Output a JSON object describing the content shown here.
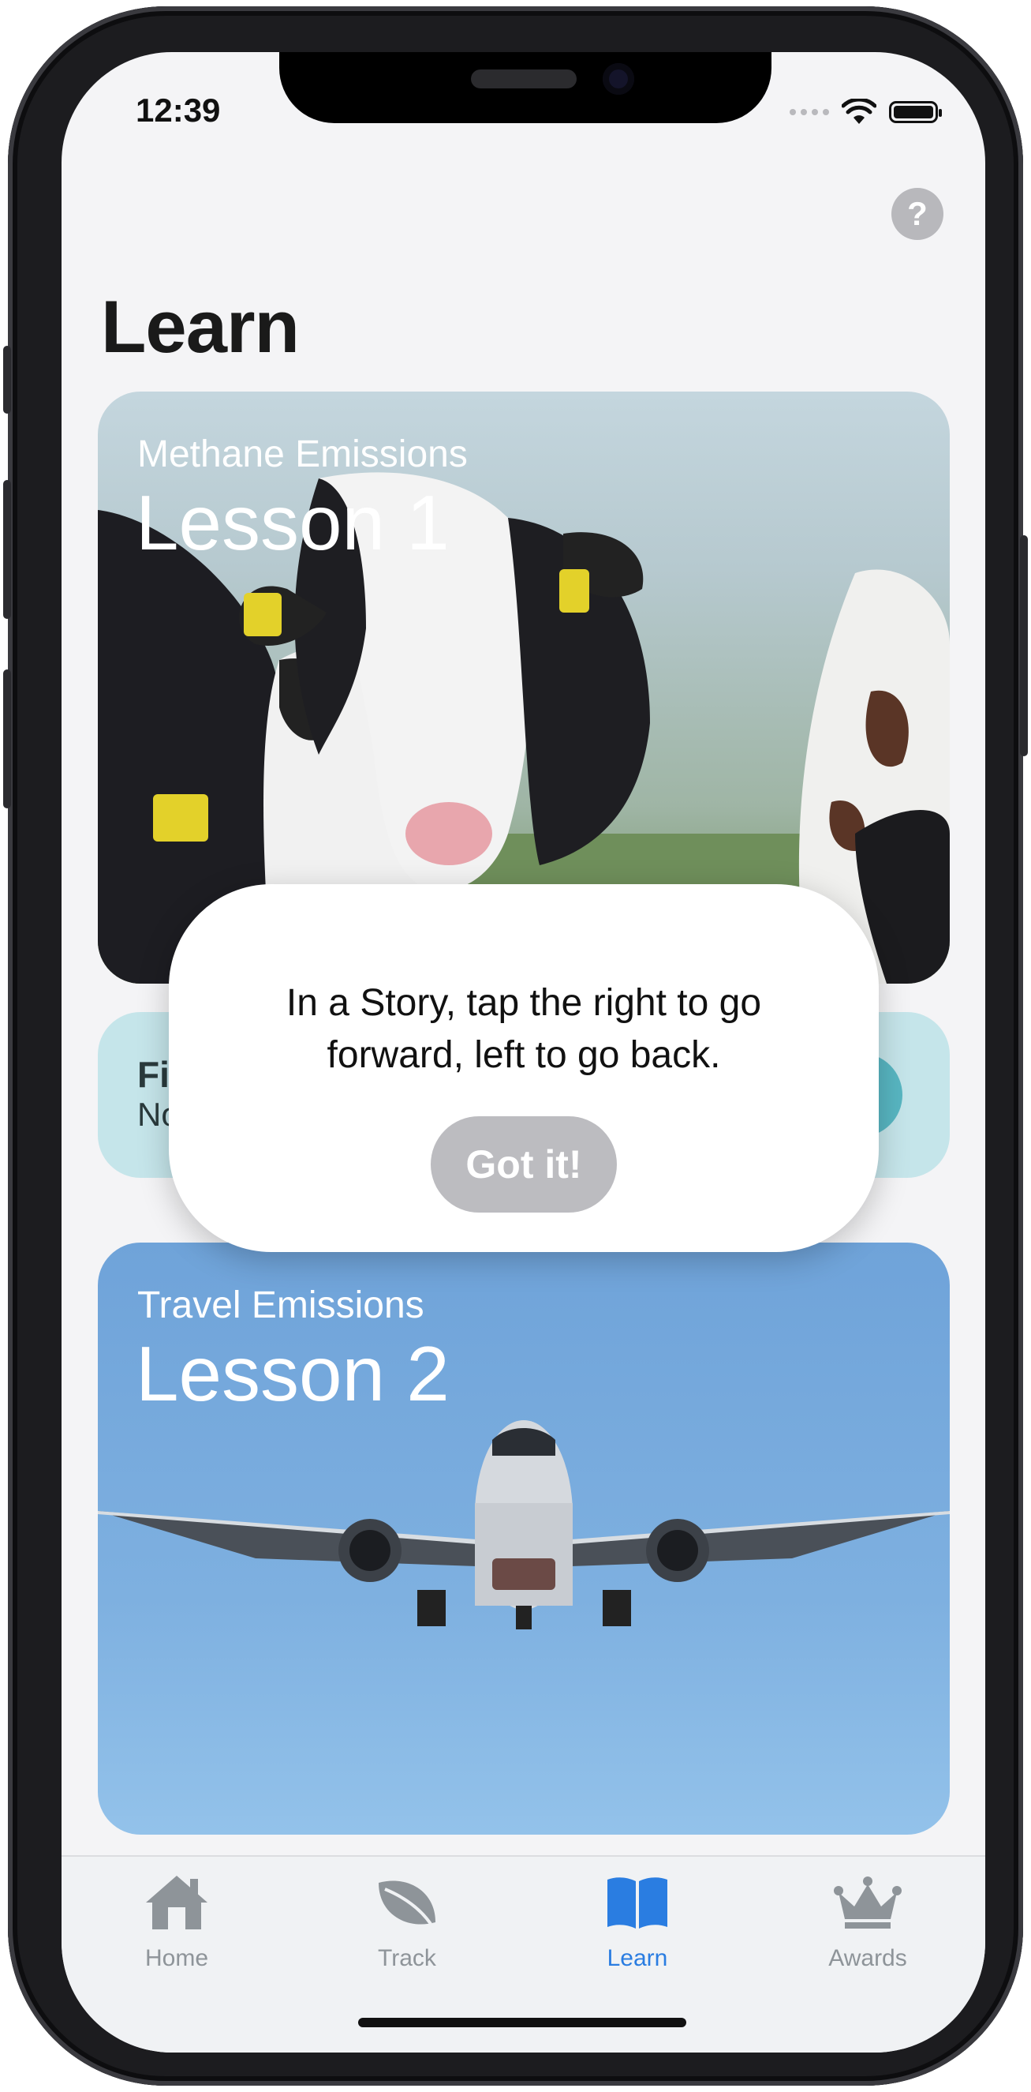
{
  "status_bar": {
    "time": "12:39"
  },
  "header": {
    "title": "Learn",
    "help_icon": "question-mark-icon",
    "help_symbol": "?"
  },
  "lessons": [
    {
      "subtitle": "Methane Emissions",
      "title": "Lesson 1",
      "image": "cows-photo"
    },
    {
      "subtitle": "Fi",
      "detail": "No",
      "image": "none"
    },
    {
      "subtitle": "Travel Emissions",
      "title": "Lesson 2",
      "image": "airplane-photo"
    }
  ],
  "popup": {
    "message": "In a Story, tap the right to go forward, left to go back.",
    "button_label": "Got it!"
  },
  "tabbar": {
    "items": [
      {
        "label": "Home",
        "icon": "house-icon",
        "active": false
      },
      {
        "label": "Track",
        "icon": "leaf-icon",
        "active": false
      },
      {
        "label": "Learn",
        "icon": "book-icon",
        "active": true
      },
      {
        "label": "Awards",
        "icon": "crown-icon",
        "active": false
      }
    ]
  },
  "colors": {
    "accent": "#2a7de1",
    "inactive_tab": "#8e9499",
    "button_gray": "#bcbcc0",
    "teal_card": "#c5e5ea"
  }
}
